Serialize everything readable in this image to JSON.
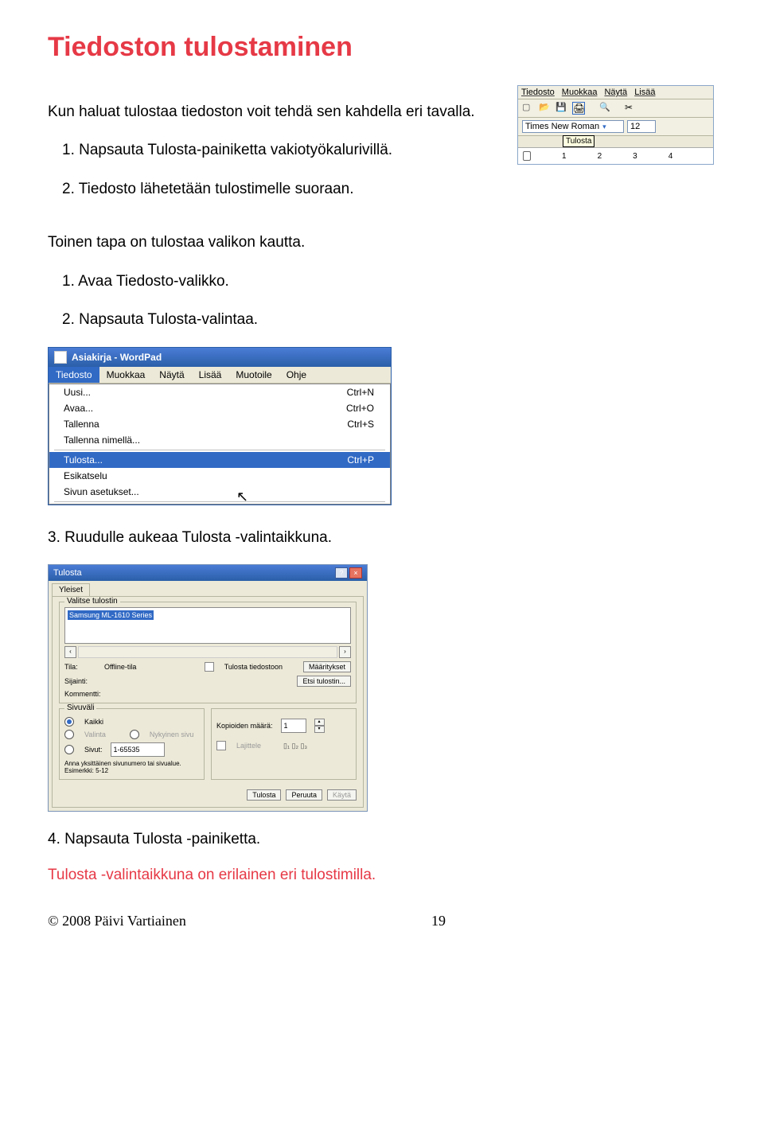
{
  "heading": "Tiedoston tulostaminen",
  "intro": "Kun haluat tulostaa tiedoston voit tehdä sen kahdella eri tavalla.",
  "steps_a": {
    "1": "1. Napsauta Tulosta-painiketta vakiotyökalurivillä.",
    "2": "2. Tiedosto lähetetään tulostimelle suoraan."
  },
  "middle_note": "Toinen tapa on tulostaa valikon kautta.",
  "steps_b": {
    "1": "1. Avaa Tiedosto-valikko.",
    "2": "2. Napsauta Tulosta-valintaa."
  },
  "step3": "3. Ruudulle aukeaa Tulosta -valintaikkuna.",
  "step4": "4. Napsauta Tulosta -painiketta.",
  "final_note": "Tulosta -valintaikkuna on erilainen eri tulostimilla.",
  "footer": {
    "copyright": "© 2008 Päivi Vartiainen",
    "page": "19"
  },
  "toolbar_snapshot": {
    "menu": [
      "Tiedosto",
      "Muokkaa",
      "Näytä",
      "Lisää"
    ],
    "font": "Times New Roman",
    "font_size": "12",
    "tooltip": "Tulosta",
    "ruler_marks": [
      "1",
      "2",
      "3",
      "4"
    ]
  },
  "wordpad": {
    "title": "Asiakirja - WordPad",
    "menubar": [
      "Tiedosto",
      "Muokkaa",
      "Näytä",
      "Lisää",
      "Muotoile",
      "Ohje"
    ],
    "items": [
      {
        "label": "Uusi...",
        "shortcut": "Ctrl+N"
      },
      {
        "label": "Avaa...",
        "shortcut": "Ctrl+O"
      },
      {
        "label": "Tallenna",
        "shortcut": "Ctrl+S"
      },
      {
        "label": "Tallenna nimellä...",
        "shortcut": ""
      }
    ],
    "selected": {
      "label": "Tulosta...",
      "shortcut": "Ctrl+P"
    },
    "items_after": [
      {
        "label": "Esikatselu",
        "shortcut": ""
      },
      {
        "label": "Sivun asetukset...",
        "shortcut": ""
      }
    ]
  },
  "print_dialog": {
    "title": "Tulosta",
    "tab": "Yleiset",
    "group_select": "Valitse tulostin",
    "printer_name": "Samsung ML-1610 Series",
    "status_label": "Tila:",
    "status": "Offline-tila",
    "location_label": "Sijainti:",
    "comment_label": "Kommentti:",
    "print_to_file": "Tulosta tiedostoon",
    "btn_prefs": "Määritykset",
    "btn_find": "Etsi tulostin...",
    "group_range": "Sivuväli",
    "opt_all": "Kaikki",
    "opt_selection": "Valinta",
    "opt_current": "Nykyinen sivu",
    "opt_pages": "Sivut:",
    "pages_value": "1-65535",
    "pages_hint1": "Anna yksittäinen sivunumero tai sivualue.",
    "pages_hint2": "Esimerkki: 5-12",
    "copies_label": "Kopioiden määrä:",
    "copies_value": "1",
    "collate": "Lajittele",
    "btn_print": "Tulosta",
    "btn_cancel": "Peruuta",
    "btn_apply": "Käytä"
  }
}
